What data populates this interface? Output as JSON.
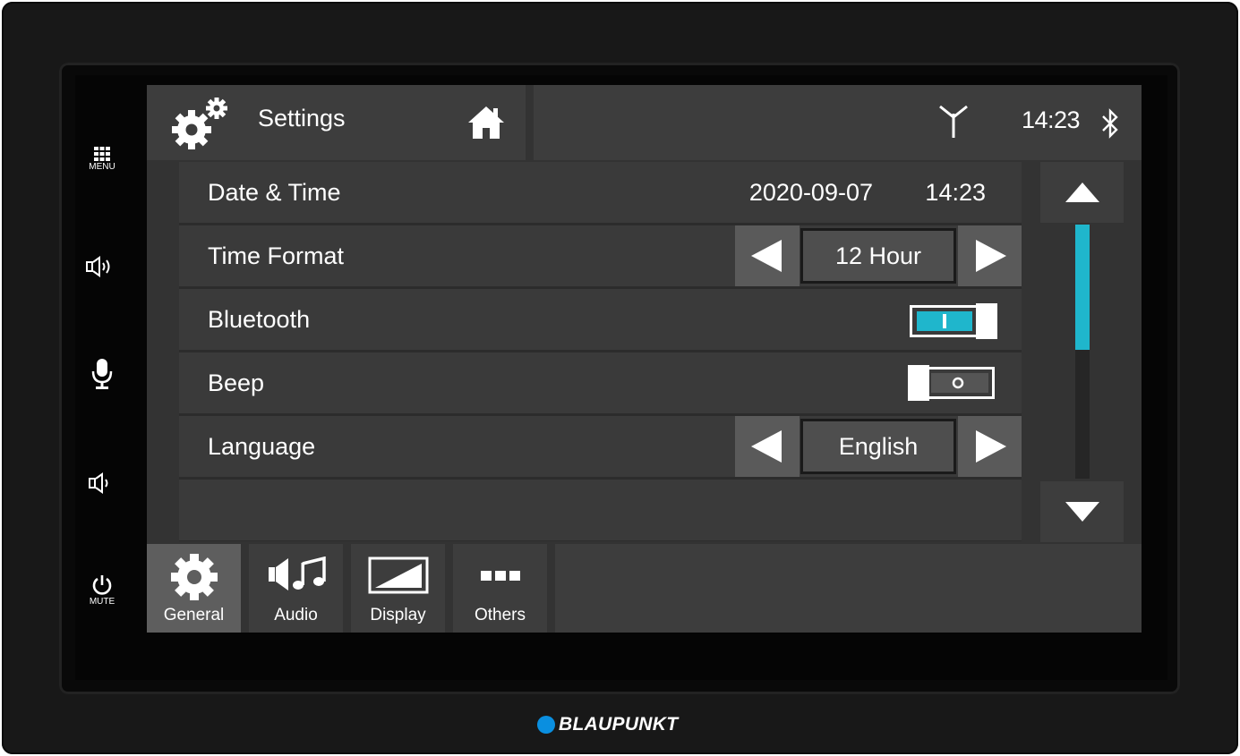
{
  "side_buttons": {
    "menu_label": "MENU",
    "mute_label": "MUTE"
  },
  "header": {
    "title": "Settings",
    "time": "14:23"
  },
  "rows": {
    "date_time": {
      "label": "Date & Time",
      "date": "2020-09-07",
      "time": "14:23"
    },
    "time_format": {
      "label": "Time Format",
      "value": "12 Hour"
    },
    "bluetooth": {
      "label": "Bluetooth",
      "state": "on"
    },
    "beep": {
      "label": "Beep",
      "state": "off"
    },
    "language": {
      "label": "Language",
      "value": "English"
    }
  },
  "tabs": [
    {
      "label": "General",
      "icon": "gear-icon",
      "active": true
    },
    {
      "label": "Audio",
      "icon": "speaker-music-icon",
      "active": false
    },
    {
      "label": "Display",
      "icon": "display-icon",
      "active": false
    },
    {
      "label": "Others",
      "icon": "dots-icon",
      "active": false
    }
  ],
  "brand": "BLAUPUNKT",
  "colors": {
    "accent": "#1fb6cc",
    "brand_dot": "#0a8fe0"
  }
}
